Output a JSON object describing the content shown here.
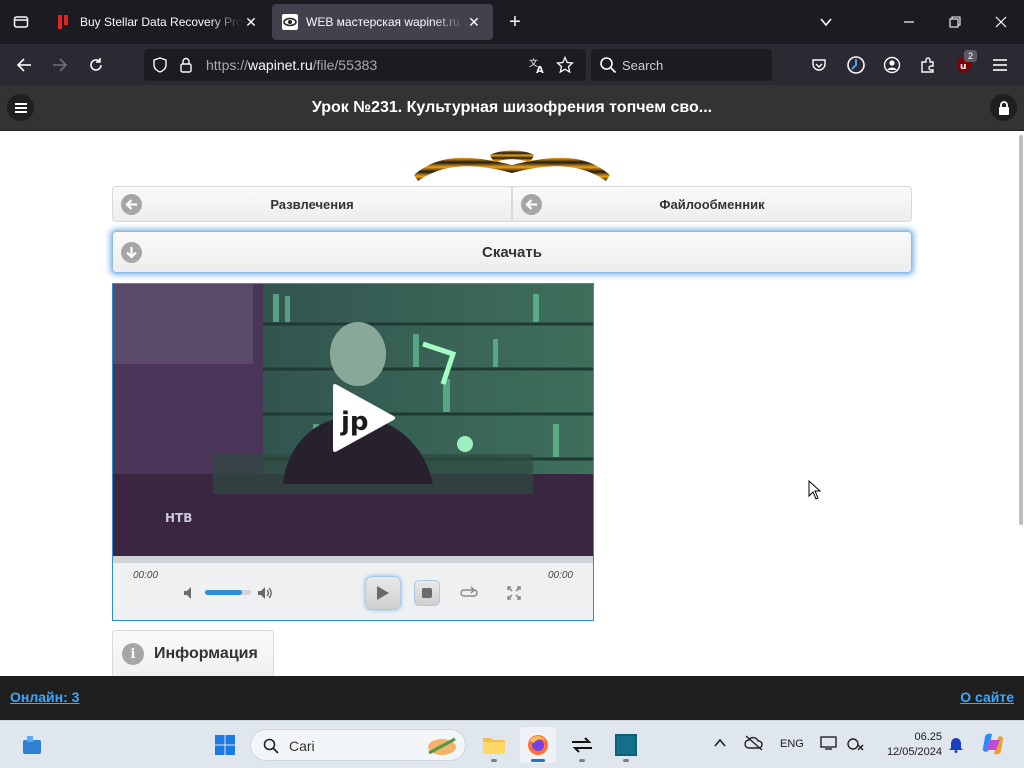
{
  "browser": {
    "tabs": [
      {
        "title": "Buy Stellar Data Recovery Profe",
        "active": false
      },
      {
        "title": "WEB мастерская wapinet.ru - У",
        "active": true
      }
    ],
    "url": {
      "prefix": "https://",
      "host": "wapinet.ru",
      "path": "/file/55383"
    },
    "search_placeholder": "Search",
    "extension_badge": "2"
  },
  "site": {
    "header_title": "Урок №231. Культурная шизофрения топчем сво...",
    "nav_buttons": {
      "left": "Развлечения",
      "right": "Файлообменник"
    },
    "download_label": "Скачать",
    "player": {
      "time_current": "00:00",
      "time_total": "00:00",
      "volume": 0.8,
      "progress": 0,
      "video_overlay_text": "jp",
      "channel_logo": "НТВ"
    },
    "info_tab_label": "Информация",
    "footer": {
      "online": "Онлайн: 3",
      "about": "О сайте"
    }
  },
  "taskbar": {
    "search_label": "Cari",
    "language": "ENG",
    "time": "06.25",
    "date": "12/05/2024"
  },
  "colors": {
    "accent": "#2a8fd8",
    "link": "#3fa7ff",
    "site_header": "#333333",
    "browser_frame": "#1c1b22"
  },
  "icons": [
    "tab-list-icon",
    "stellar-favicon",
    "wapinet-favicon",
    "close-icon",
    "new-tab-icon",
    "chevron-down-icon",
    "minimize-icon",
    "maximize-icon",
    "back-arrow-icon",
    "forward-arrow-icon",
    "reload-icon",
    "shield-icon",
    "lock-icon",
    "translate-icon",
    "star-icon",
    "search-icon",
    "pocket-icon",
    "sync-icon",
    "account-icon",
    "extensions-icon",
    "ublock-icon",
    "hamburger-menu-icon",
    "arrow-left-icon",
    "arrow-down-icon",
    "play-icon",
    "stop-icon",
    "volume-mute-icon",
    "volume-max-icon",
    "repeat-icon",
    "fullscreen-icon",
    "info-icon",
    "windows-start-icon",
    "folder-icon",
    "firefox-icon",
    "remote-icon",
    "app-icon",
    "wifi-icon",
    "notification-bell-icon"
  ]
}
